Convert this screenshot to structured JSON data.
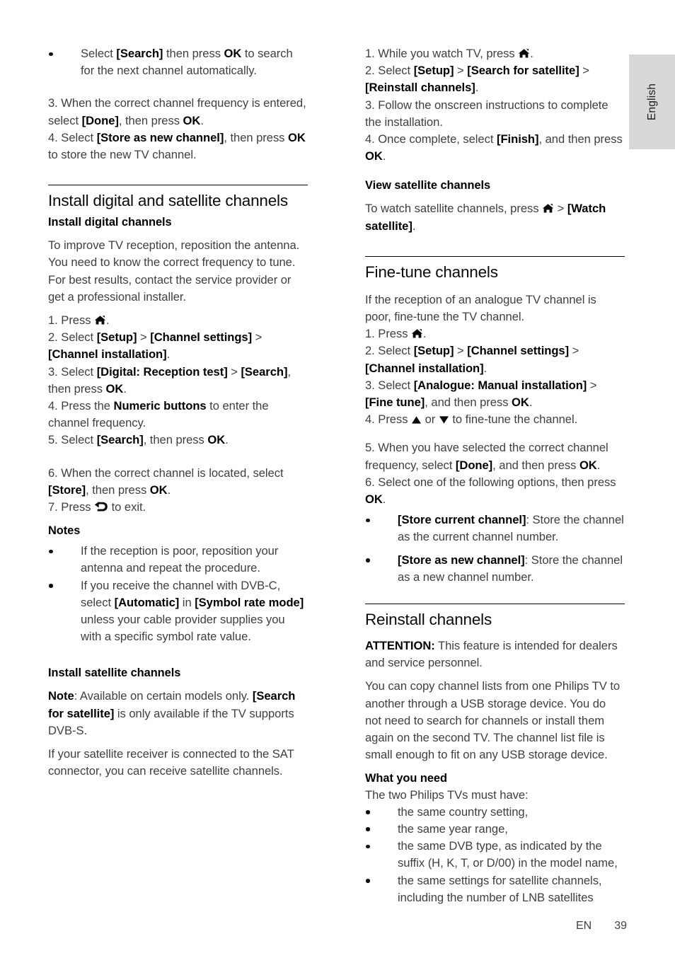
{
  "page": {
    "language_tab": "English",
    "footer_locale": "EN",
    "footer_page_number": "39"
  },
  "icons": {
    "home": "home-icon",
    "back": "back-arrow-icon",
    "up": "up-arrow-icon",
    "down": "down-arrow-icon",
    "bullet": "bullet-dot"
  },
  "left_column": {
    "bullet_search_next": {
      "t1": "Select ",
      "b1": "[Search]",
      "t2": " then press ",
      "b2": "OK",
      "t3": " to search for the next channel automatically."
    },
    "steps_3_4": {
      "l1a": "3. When the correct channel frequency is entered, select ",
      "l1b": "[Done]",
      "l1c": ", then press ",
      "l1d": "OK",
      "l1e": ".",
      "l2a": "4. Select ",
      "l2b": "[Store as new channel]",
      "l2c": ", then press ",
      "l2d": "OK",
      "l2e": " to store the new TV channel."
    },
    "heading_main": "Install digital and satellite channels",
    "heading_install_digital": "Install digital channels",
    "intro_digital": "To improve TV reception, reposition the antenna. You need to know the correct frequency to tune. For best results, contact the service provider or get a professional installer.",
    "steps_digital": {
      "s1a": "1. Press ",
      "s1b": ".",
      "s2a": "2. Select ",
      "s2b": "[Setup]",
      "s2c": " > ",
      "s2d": "[Channel settings]",
      "s2e": " > ",
      "s2f": "[Channel installation]",
      "s2g": ".",
      "s3a": "3. Select ",
      "s3b": "[Digital: Reception test]",
      "s3c": " > ",
      "s3d": "[Search]",
      "s3e": ", then press ",
      "s3f": "OK",
      "s3g": ".",
      "s4a": "4. Press the ",
      "s4b": "Numeric buttons",
      "s4c": " to enter the channel frequency.",
      "s5a": "5. Select ",
      "s5b": "[Search]",
      "s5c": ", then press ",
      "s5d": "OK",
      "s5e": "."
    },
    "steps_digital_cont": {
      "s6a": "6. When the correct channel is located, select ",
      "s6b": "[Store]",
      "s6c": ", then press ",
      "s6d": "OK",
      "s6e": ".",
      "s7a": "7. Press ",
      "s7b": " to exit."
    },
    "heading_notes": "Notes",
    "notes": {
      "n1": "If the reception is poor, reposition your antenna and repeat the procedure.",
      "n2a": "If you receive the channel with DVB-C, select ",
      "n2b": "[Automatic]",
      "n2c": " in ",
      "n2d": "[Symbol rate mode]",
      "n2e": " unless your cable provider supplies you with a specific symbol rate value."
    },
    "heading_install_satellite": "Install satellite channels",
    "note_satellite": {
      "a": "Note",
      "b": ": Available on certain models only. ",
      "c": "[Search for satellite]",
      "d": " is only available if the TV supports DVB-S."
    },
    "satellite_receiver": "If your satellite receiver is connected to the SAT connector, you can receive satellite channels."
  },
  "right_column": {
    "steps_satellite": {
      "s1a": "1. While you watch TV, press ",
      "s1b": ".",
      "s2a": "2. Select ",
      "s2b": "[Setup]",
      "s2c": " > ",
      "s2d": "[Search for satellite]",
      "s2e": " > ",
      "s2f": "[Reinstall channels]",
      "s2g": ".",
      "s3": "3. Follow the onscreen instructions to complete the installation.",
      "s4a": "4. Once complete, select ",
      "s4b": "[Finish]",
      "s4c": ", and then press ",
      "s4d": "OK",
      "s4e": "."
    },
    "heading_view_satellite": "View satellite channels",
    "view_satellite": {
      "a": "To watch satellite channels, press ",
      "b": " > ",
      "c": "[Watch satellite]",
      "d": "."
    },
    "heading_fine_tune": "Fine-tune channels",
    "fine_tune_intro": "If the reception of an analogue TV channel is poor, fine-tune the TV channel.",
    "steps_fine_tune": {
      "s1a": "1. Press ",
      "s1b": ".",
      "s2a": "2. Select ",
      "s2b": "[Setup]",
      "s2c": " > ",
      "s2d": "[Channel settings]",
      "s2e": " > ",
      "s2f": "[Channel installation]",
      "s2g": ".",
      "s3a": "3. Select ",
      "s3b": "[Analogue: Manual installation]",
      "s3c": " > ",
      "s3d": "[Fine tune]",
      "s3e": ", and then press ",
      "s3f": "OK",
      "s3g": ".",
      "s4a": "4. Press ",
      "s4b": " or ",
      "s4c": " to fine-tune the channel."
    },
    "steps_fine_tune_cont": {
      "s5a": "5. When you have selected the correct channel frequency, select ",
      "s5b": "[Done]",
      "s5c": ", and then press ",
      "s5d": "OK",
      "s5e": ".",
      "s6a": "6. Select one of the following options, then press ",
      "s6b": "OK",
      "s6c": "."
    },
    "options": {
      "o1a": "[Store current channel]",
      "o1b": ": Store the channel as the current channel number.",
      "o2a": "[Store as new channel]",
      "o2b": ": Store the channel as a new channel number."
    },
    "heading_reinstall": "Reinstall channels",
    "attention": {
      "a": "ATTENTION:",
      "b": " This feature is intended for dealers and service personnel."
    },
    "copy_lists": "You can copy channel lists from one Philips TV to another through a USB storage device. You do not need to search for channels or install them again on the second TV. The channel list file is small enough to fit on any USB storage device.",
    "heading_what_you_need": "What you need",
    "must_have_intro": "The two Philips TVs must have:",
    "must_have": {
      "m1": "the same country setting,",
      "m2": "the same year range,",
      "m3": "the same DVB type, as indicated by the suffix (H, K, T, or D/00) in the model name,",
      "m4": "the same settings for satellite channels, including the number of LNB satellites"
    }
  }
}
